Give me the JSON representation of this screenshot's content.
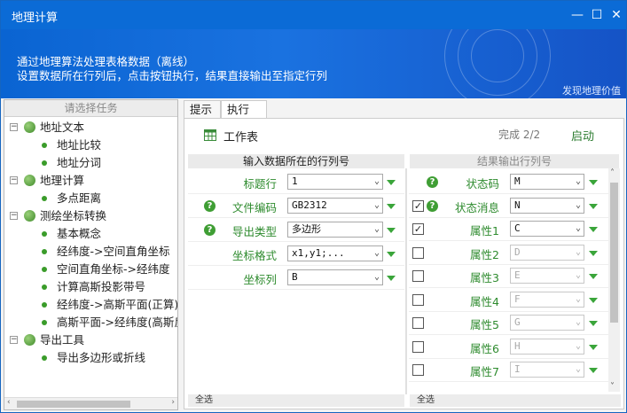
{
  "window": {
    "title": "地理计算",
    "controls": {
      "min": "—",
      "max": "☐",
      "close": "✕"
    }
  },
  "banner": {
    "line1": "通过地理算法处理表格数据（离线）",
    "line2": "设置数据所在行列后，点击按钮执行，结果直接输出至指定行列",
    "slogan": "发现地理价值"
  },
  "left": {
    "header": "请选择任务",
    "groups": [
      {
        "label": "地址文本",
        "items": [
          "地址比较",
          "地址分词"
        ]
      },
      {
        "label": "地理计算",
        "items": [
          "多点距离"
        ]
      },
      {
        "label": "测绘坐标转换",
        "items": [
          "基本概念",
          "经纬度->空间直角坐标",
          "空间直角坐标->经纬度",
          "计算高斯投影带号",
          "经纬度->高斯平面(正算)",
          "高斯平面->经纬度(高斯反"
        ]
      },
      {
        "label": "导出工具",
        "items": [
          "导出多边形或折线"
        ]
      }
    ]
  },
  "tabs": [
    "提示",
    "执行"
  ],
  "toolbar": {
    "worksheet": "工作表",
    "status": "完成 2/2",
    "start": "启动"
  },
  "input": {
    "title": "输入数据所在的行列号",
    "rows": [
      {
        "label": "标题行",
        "value": "1",
        "help": false
      },
      {
        "label": "文件编码",
        "value": "GB2312",
        "help": true
      },
      {
        "label": "导出类型",
        "value": "多边形",
        "help": true
      },
      {
        "label": "坐标格式",
        "value": "x1,y1;...",
        "help": false
      },
      {
        "label": "坐标列",
        "value": "B",
        "help": false
      }
    ],
    "footer": "全选"
  },
  "output": {
    "title": "结果输出行列号",
    "rows": [
      {
        "label": "状态码",
        "value": "M",
        "checkbox": false,
        "checked": false,
        "help": true,
        "disabled": false
      },
      {
        "label": "状态消息",
        "value": "N",
        "checkbox": true,
        "checked": true,
        "help": true,
        "disabled": false
      },
      {
        "label": "属性1",
        "value": "C",
        "checkbox": true,
        "checked": true,
        "help": false,
        "disabled": false
      },
      {
        "label": "属性2",
        "value": "D",
        "checkbox": true,
        "checked": false,
        "help": false,
        "disabled": true
      },
      {
        "label": "属性3",
        "value": "E",
        "checkbox": true,
        "checked": false,
        "help": false,
        "disabled": true
      },
      {
        "label": "属性4",
        "value": "F",
        "checkbox": true,
        "checked": false,
        "help": false,
        "disabled": true
      },
      {
        "label": "属性5",
        "value": "G",
        "checkbox": true,
        "checked": false,
        "help": false,
        "disabled": true
      },
      {
        "label": "属性6",
        "value": "H",
        "checkbox": true,
        "checked": false,
        "help": false,
        "disabled": true
      },
      {
        "label": "属性7",
        "value": "I",
        "checkbox": true,
        "checked": false,
        "help": false,
        "disabled": true
      }
    ],
    "footer": "全选"
  },
  "colors": {
    "titlebar": "#0b6bd6",
    "label_green": "#2e8b2e",
    "accent_green": "#3aa53a"
  }
}
